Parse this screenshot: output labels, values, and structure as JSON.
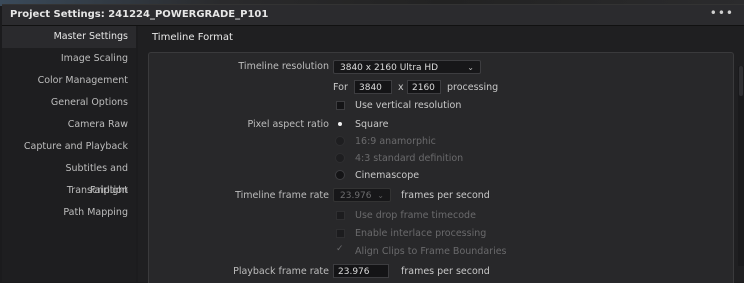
{
  "window": {
    "title": "Project Settings:  241224_POWERGRADE_P101",
    "menu_label": "•••"
  },
  "sidebar": {
    "items": [
      {
        "label": "Master Settings",
        "active": true
      },
      {
        "label": "Image Scaling"
      },
      {
        "label": "Color Management"
      },
      {
        "label": "General Options"
      },
      {
        "label": "Camera Raw"
      },
      {
        "label": "Capture and Playback"
      },
      {
        "label": "Subtitles and Transcription"
      },
      {
        "label": "Fairlight"
      },
      {
        "label": "Path Mapping"
      }
    ]
  },
  "main": {
    "section_title": "Timeline Format",
    "timeline_resolution": {
      "label": "Timeline resolution",
      "value": "3840 x 2160 Ultra HD",
      "for_label": "For",
      "width": "3840",
      "x_label": "x",
      "height": "2160",
      "processing_label": "processing"
    },
    "use_vertical": {
      "label": "Use vertical resolution",
      "checked": false
    },
    "pixel_aspect": {
      "label": "Pixel aspect ratio",
      "options": [
        {
          "label": "Square",
          "selected": true,
          "enabled": true
        },
        {
          "label": "16:9 anamorphic",
          "selected": false,
          "enabled": false
        },
        {
          "label": "4:3 standard definition",
          "selected": false,
          "enabled": false
        },
        {
          "label": "Cinemascope",
          "selected": false,
          "enabled": true
        }
      ]
    },
    "frame_rate": {
      "label": "Timeline frame rate",
      "value": "23.976",
      "suffix": "frames per second"
    },
    "checks": [
      {
        "label": "Use drop frame timecode",
        "checked": false,
        "enabled": false
      },
      {
        "label": "Enable interlace processing",
        "checked": false,
        "enabled": false
      },
      {
        "label": "Align Clips to Frame Boundaries",
        "checked": true,
        "enabled": false
      }
    ],
    "playback": {
      "label": "Playback frame rate",
      "value": "23.976",
      "suffix": "frames per second"
    }
  }
}
